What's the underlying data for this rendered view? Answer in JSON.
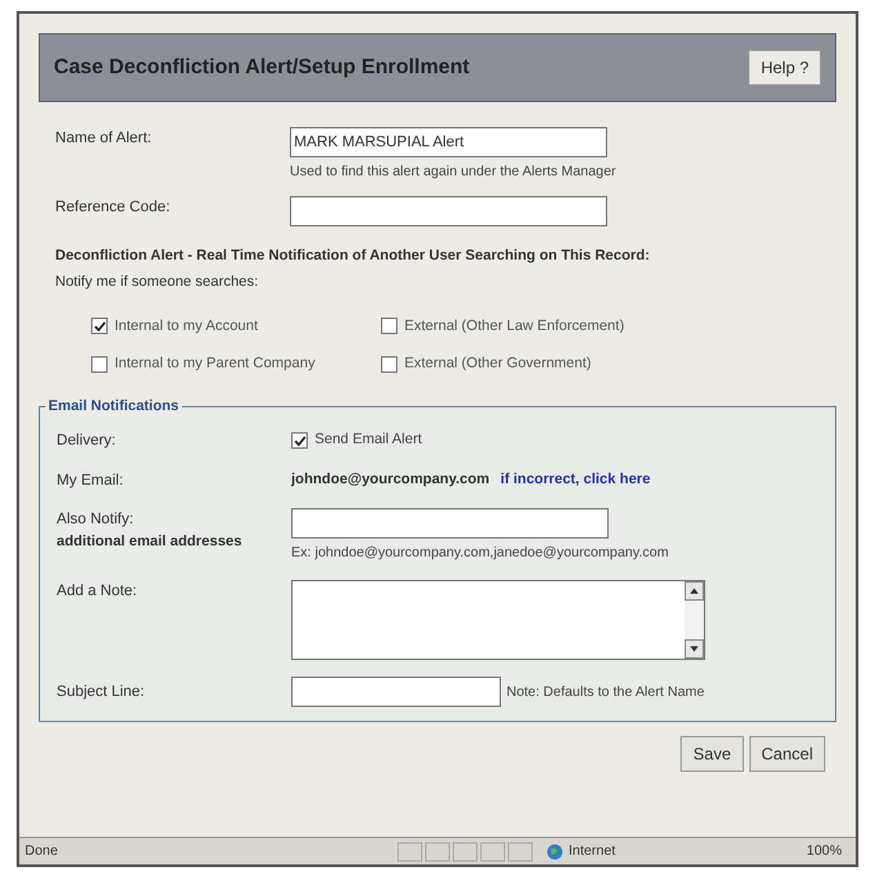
{
  "header": {
    "title": "Case Deconfliction Alert/Setup Enrollment",
    "help_button": "Help ?"
  },
  "name_of_alert": {
    "label": "Name of Alert:",
    "value": "MARK MARSUPIAL Alert",
    "hint": "Used to find this alert again under the Alerts Manager"
  },
  "reference_code": {
    "label": "Reference Code:"
  },
  "deconfliction": {
    "heading": "Deconfliction Alert - Real Time Notification of Another User Searching on This Record:",
    "subheading": "Notify me if someone searches:",
    "options": [
      {
        "label": "Internal to my Account",
        "checked": true
      },
      {
        "label": "External (Other Law Enforcement)",
        "checked": false
      },
      {
        "label": "Internal to my Parent Company",
        "checked": false
      },
      {
        "label": "External (Other Government)",
        "checked": false
      }
    ]
  },
  "email_notifications": {
    "legend": "Email Notifications",
    "delivery_label": "Delivery:",
    "send_email": {
      "label": "Send Email Alert",
      "checked": true
    },
    "my_email_label": "My Email:",
    "my_email": "johndoe@yourcompany.com",
    "incorrect_link": "if incorrect, click here",
    "also_notify_label": "Also Notify:",
    "also_notify_sublabel": "additional email addresses",
    "also_notify_example": "Ex: johndoe@yourcompany.com,janedoe@yourcompany.com",
    "note_label": "Add a Note:",
    "subject_label": "Subject Line:",
    "subject_hint": "Note: Defaults to the Alert Name"
  },
  "buttons": [
    "Save",
    "Cancel"
  ],
  "status_bar": {
    "status": "Done",
    "zone": "Internet",
    "zoom": "100%"
  }
}
